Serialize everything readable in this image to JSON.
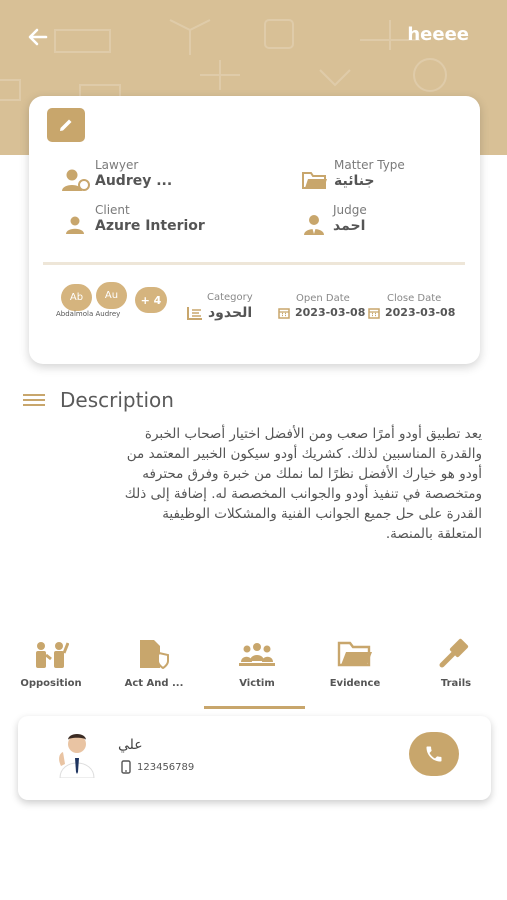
{
  "header": {
    "title": "heeee",
    "back_icon": "arrow-left-icon",
    "background_color": "#d8c096"
  },
  "case_card": {
    "edit_icon": "pencil-icon",
    "lawyer": {
      "label": "Lawyer",
      "value": "Audrey ..."
    },
    "matter_type": {
      "label": "Matter Type",
      "value": "جنائية"
    },
    "client": {
      "label": "Client",
      "value": "Azure Interior"
    },
    "judge": {
      "label": "Judge",
      "value": "احمد"
    },
    "avatars": [
      "Ab",
      "Au"
    ],
    "more_count": "+ 4",
    "avatar_names": "Abdalmola Audrey",
    "category": {
      "label": "Category",
      "value": "الحدود"
    },
    "open_date": {
      "label": "Open Date",
      "value": "2023-03-08"
    },
    "close_date": {
      "label": "Close Date",
      "value": "2023-03-08"
    }
  },
  "description": {
    "title": "Description",
    "lines": [
      "يعد تطبيق أودو أمرًا صعب ومن الأفضل اختيار أصحاب الخبرة",
      "والقدرة المناسبين لذلك. كشريك أودو سيكون الخبير المعتمد من",
      "أودو هو خيارك الأفضل نظرًا لما نملك من خبرة وفرق محترفه",
      "ومتخصصة في تنفيذ أودو والجوانب المخصصة له. إضافة إلى ذلك",
      "القدرة على حل جميع الجوانب الفنية والمشكلات الوظيفية",
      "المتعلقة بالمنصة."
    ]
  },
  "tabs": [
    {
      "label": "Opposition",
      "icon": "people-icon"
    },
    {
      "label": "Act And ...",
      "icon": "document-shield-icon"
    },
    {
      "label": "Victim",
      "icon": "group-icon",
      "active": true
    },
    {
      "label": "Evidence",
      "icon": "folder-icon"
    },
    {
      "label": "Trails",
      "icon": "gavel-icon"
    }
  ],
  "contact": {
    "name": "علي",
    "phone": "123456789",
    "phone_icon": "mobile-phone-icon",
    "call_icon": "phone-icon"
  },
  "colors": {
    "accent": "#c8a66c",
    "badge": "#d5b47e"
  }
}
